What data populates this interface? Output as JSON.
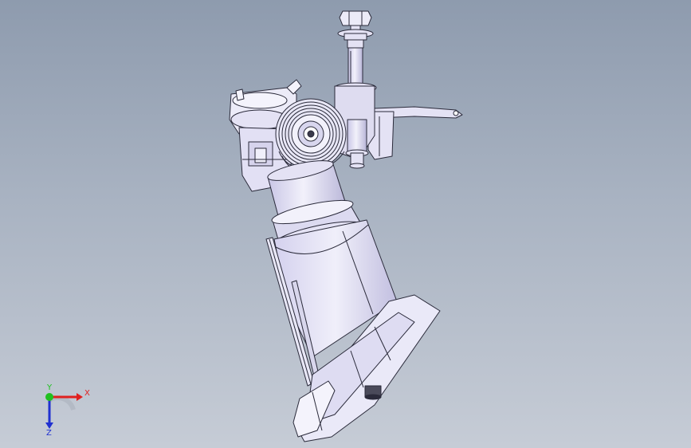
{
  "viewport": {
    "background_top": "#8e9bae",
    "background_bottom": "#c6ccd6",
    "part_fill": "#e4e2f4",
    "part_stroke": "#2a2a3a"
  },
  "triad": {
    "x_label": "X",
    "y_label": "Y",
    "z_label": "Z",
    "x_color": "#e02020",
    "y_color": "#20c020",
    "z_color": "#2030d0"
  }
}
